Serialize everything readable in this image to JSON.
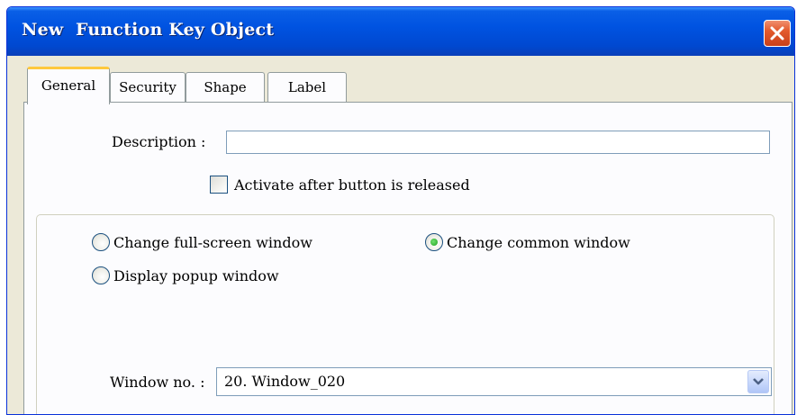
{
  "window": {
    "title": "New  Function Key Object"
  },
  "tabs": [
    {
      "label": "General",
      "active": true
    },
    {
      "label": "Security",
      "active": false
    },
    {
      "label": "Shape",
      "active": false
    },
    {
      "label": "Label",
      "active": false
    }
  ],
  "general": {
    "description_label": "Description :",
    "description_value": "",
    "activate_checkbox": {
      "label": "Activate after button is released",
      "checked": false
    },
    "mode_options": [
      {
        "label": "Change full-screen window",
        "selected": false
      },
      {
        "label": "Change common window",
        "selected": true
      },
      {
        "label": "Display popup window",
        "selected": false
      }
    ],
    "window_no_label": "Window no. :",
    "window_no_value": "20. Window_020"
  },
  "icons": {
    "close": "close-icon",
    "dropdown": "chevron-down-icon"
  },
  "colors": {
    "titlebar": "#0053e1",
    "close_button": "#e35a2d",
    "active_tab_accent": "#ffc83c",
    "dialog_bg": "#ece9d8"
  }
}
